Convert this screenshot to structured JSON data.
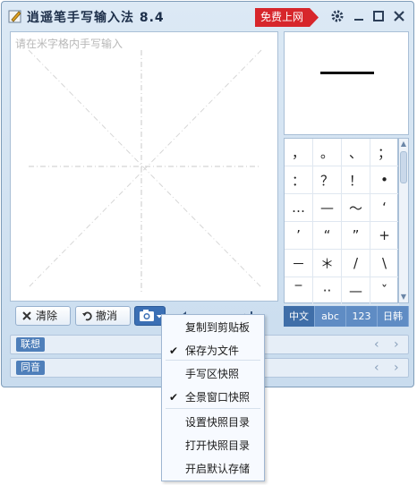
{
  "app": {
    "title": "逍遥笔手写输入法 8.4",
    "free_label": "免费上网"
  },
  "canvas": {
    "placeholder": "请在米字格内手写输入"
  },
  "preview": {
    "character": "一"
  },
  "symbols": [
    "，",
    "。",
    "、",
    "；",
    "：",
    "？",
    "！",
    "•",
    "…",
    "—",
    "～",
    "‘",
    "’",
    "“",
    "”",
    "+",
    "－",
    "＊",
    "/",
    "\\",
    "‾",
    "··",
    "—",
    "ˇ"
  ],
  "modes": [
    "中文",
    "abc",
    "123",
    "日韩"
  ],
  "active_mode": "中文",
  "toolbar": {
    "clear_label": "清除",
    "undo_label": "撤消"
  },
  "strips": {
    "association_label": "联想",
    "homophone_label": "同音"
  },
  "menu": {
    "items": [
      {
        "label": "复制到剪贴板",
        "checked": false
      },
      {
        "label": "保存为文件",
        "checked": true
      },
      {
        "label": "手写区快照",
        "checked": false
      },
      {
        "label": "全景窗口快照",
        "checked": true
      },
      {
        "label": "设置快照目录",
        "checked": false
      },
      {
        "label": "打开快照目录",
        "checked": false
      },
      {
        "label": "开启默认存储",
        "checked": false
      }
    ]
  },
  "colors": {
    "accent_blue": "#3f6ea8",
    "free_red": "#d7262b"
  }
}
